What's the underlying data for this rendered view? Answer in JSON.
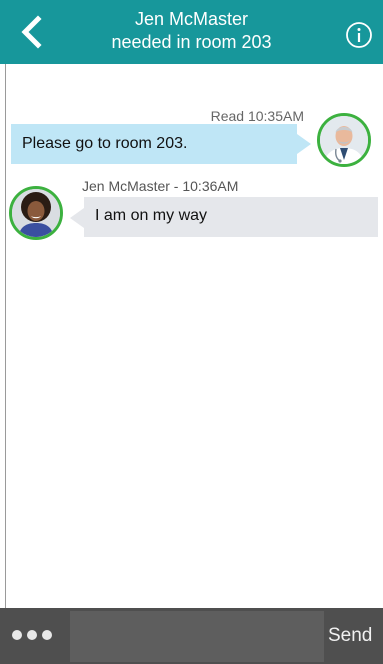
{
  "header": {
    "title_line1": "Jen McMaster",
    "title_line2": "needed in room 203",
    "back_icon": "chevron-left-icon",
    "info_icon": "info-circle-icon",
    "color": "#17979b"
  },
  "messages": [
    {
      "direction": "outgoing",
      "status": "Read 10:35AM",
      "text": "Please go to room 203.",
      "avatar": "doctor-avatar",
      "bubble_color": "#bfe6f6"
    },
    {
      "direction": "incoming",
      "sender_line": "Jen McMaster - 10:36AM",
      "text": "I am on my way",
      "avatar": "nurse-avatar",
      "bubble_color": "#e5e7eb"
    }
  ],
  "composer": {
    "more_icon": "more-dots-icon",
    "input_value": "",
    "send_label": "Send"
  },
  "colors": {
    "avatar_ring": "#3cb13f",
    "composer_bg": "#4f4f4f"
  }
}
